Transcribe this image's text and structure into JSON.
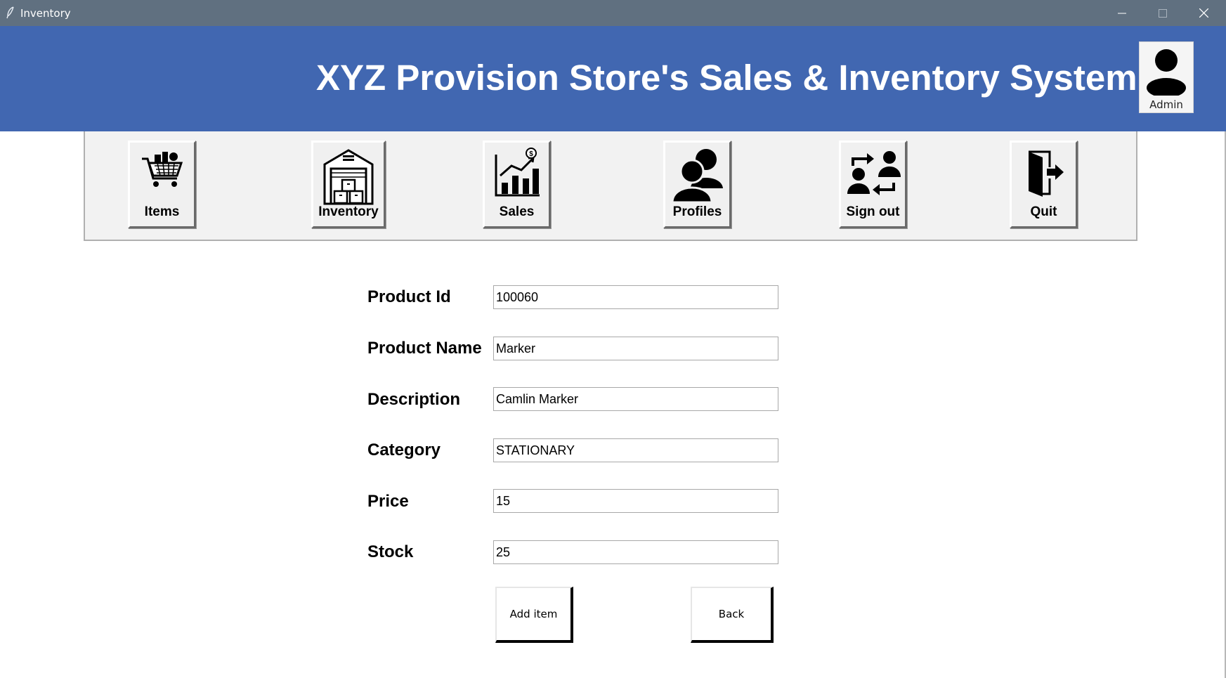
{
  "window": {
    "title": "Inventory",
    "minimize_icon": "minimize-icon",
    "maximize_icon": "maximize-icon",
    "close_icon": "close-icon"
  },
  "header": {
    "title": "XYZ Provision Store's Sales & Inventory System",
    "user_label": "Admin",
    "background": "#4167b1"
  },
  "toolbar": {
    "items": [
      {
        "label": "Items",
        "icon": "shopping-cart-icon"
      },
      {
        "label": "Inventory",
        "icon": "warehouse-icon"
      },
      {
        "label": "Sales",
        "icon": "sales-chart-icon"
      },
      {
        "label": "Profiles",
        "icon": "users-icon"
      },
      {
        "label": "Sign out",
        "icon": "switch-user-icon"
      },
      {
        "label": "Quit",
        "icon": "exit-door-icon"
      }
    ]
  },
  "form": {
    "product_id": {
      "label": "Product Id",
      "value": "100060"
    },
    "product_name": {
      "label": "Product Name",
      "value": "Marker"
    },
    "description": {
      "label": "Description",
      "value": "Camlin Marker"
    },
    "category": {
      "label": "Category",
      "value": "STATIONARY"
    },
    "price": {
      "label": "Price",
      "value": "15"
    },
    "stock": {
      "label": "Stock",
      "value": "25"
    }
  },
  "actions": {
    "add_label": "Add item",
    "back_label": "Back"
  }
}
